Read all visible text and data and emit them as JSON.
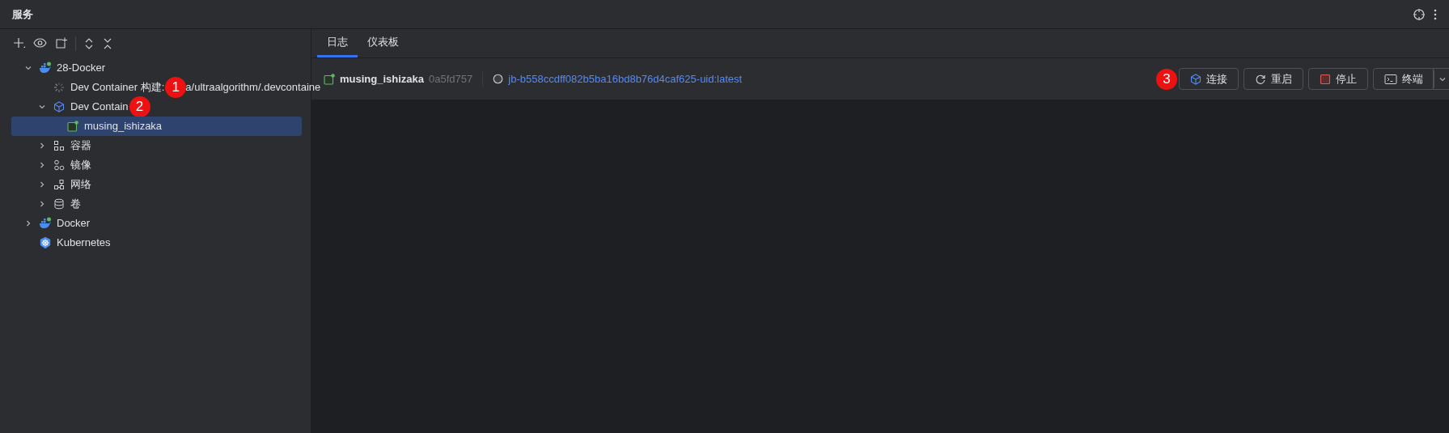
{
  "panel_title": "服务",
  "tree": [
    {
      "label": "28-Docker",
      "kind": "docker",
      "expanded": true,
      "selected": false,
      "children": [
        {
          "label": "Dev Container 构建:",
          "badge": "1",
          "label_after": "a/ultraalgorithm/.devcontaine",
          "kind": "spinner",
          "selected": false
        },
        {
          "label": "Dev Contain",
          "badge": "2",
          "kind": "cube",
          "expanded": true,
          "selected": false,
          "children": [
            {
              "label": "musing_ishizaka",
              "kind": "container",
              "selected": true
            }
          ]
        },
        {
          "label": "容器",
          "kind": "containers",
          "expanded": false,
          "selected": false
        },
        {
          "label": "镜像",
          "kind": "images",
          "expanded": false,
          "selected": false
        },
        {
          "label": "网络",
          "kind": "network",
          "expanded": false,
          "selected": false
        },
        {
          "label": "卷",
          "kind": "volume",
          "expanded": false,
          "selected": false
        }
      ]
    },
    {
      "label": "Docker",
      "kind": "docker",
      "expanded": false,
      "selected": false
    },
    {
      "label": "Kubernetes",
      "kind": "kubernetes",
      "selected": false
    }
  ],
  "tabs": [
    {
      "label": "日志",
      "selected": true
    },
    {
      "label": "仪表板",
      "selected": false
    }
  ],
  "container": {
    "name": "musing_ishizaka",
    "id": "0a5fd757",
    "image": "jb-b558ccdff082b5ba16bd8b76d4caf625-uid:latest"
  },
  "actions": [
    {
      "label": "连接",
      "kind": "connect",
      "badge": "3"
    },
    {
      "label": "重启",
      "kind": "restart"
    },
    {
      "label": "停止",
      "kind": "stop"
    },
    {
      "label": "终端",
      "kind": "terminal"
    }
  ]
}
